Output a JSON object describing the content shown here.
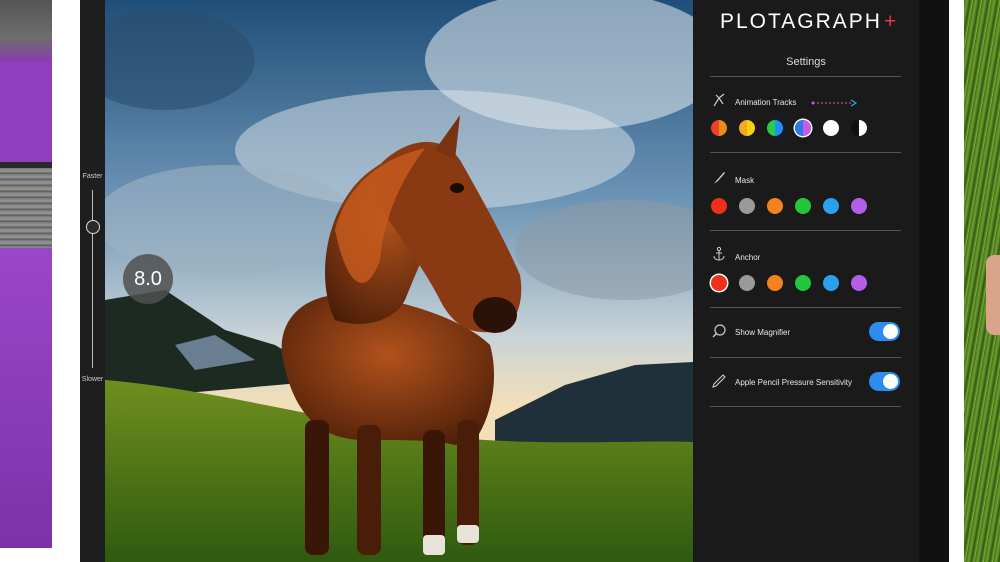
{
  "app": {
    "logo": "PLOTAGRAPH",
    "logo_plus": "+"
  },
  "speed_slider": {
    "top_label": "Faster",
    "bottom_label": "Slower",
    "value": "8.0"
  },
  "settings": {
    "title": "Settings",
    "animation_tracks": {
      "label": "Animation Tracks",
      "swatches": [
        {
          "name": "red-orange",
          "colors": [
            "#e8442c",
            "#f08a1c"
          ]
        },
        {
          "name": "orange-yellow",
          "colors": [
            "#f5a623",
            "#f3d11a"
          ]
        },
        {
          "name": "green-blue",
          "colors": [
            "#2ecc40",
            "#1e90ff"
          ]
        },
        {
          "name": "blue-purple",
          "colors": [
            "#2c7be5",
            "#c25be8"
          ]
        },
        {
          "name": "white",
          "colors": [
            "#ffffff",
            "#ffffff"
          ]
        },
        {
          "name": "black-white",
          "colors": [
            "#111111",
            "#ffffff"
          ]
        }
      ]
    },
    "mask": {
      "label": "Mask",
      "colors": [
        "#f0301c",
        "#9a9a9a",
        "#f5821f",
        "#22c73a",
        "#2aa0ee",
        "#b25ee8"
      ]
    },
    "anchor": {
      "label": "Anchor",
      "colors": [
        "#f0301c",
        "#9a9a9a",
        "#f5821f",
        "#22c73a",
        "#2aa0ee",
        "#b25ee8"
      ]
    },
    "show_magnifier": {
      "label": "Show Magnifier",
      "on": true
    },
    "pencil_pressure": {
      "label": "Apple Pencil Pressure Sensitivity",
      "on": true
    }
  },
  "colors": {
    "accent": "#2d8cf0",
    "brand": "#e8344c",
    "panel_bg": "#1a1a1a"
  }
}
